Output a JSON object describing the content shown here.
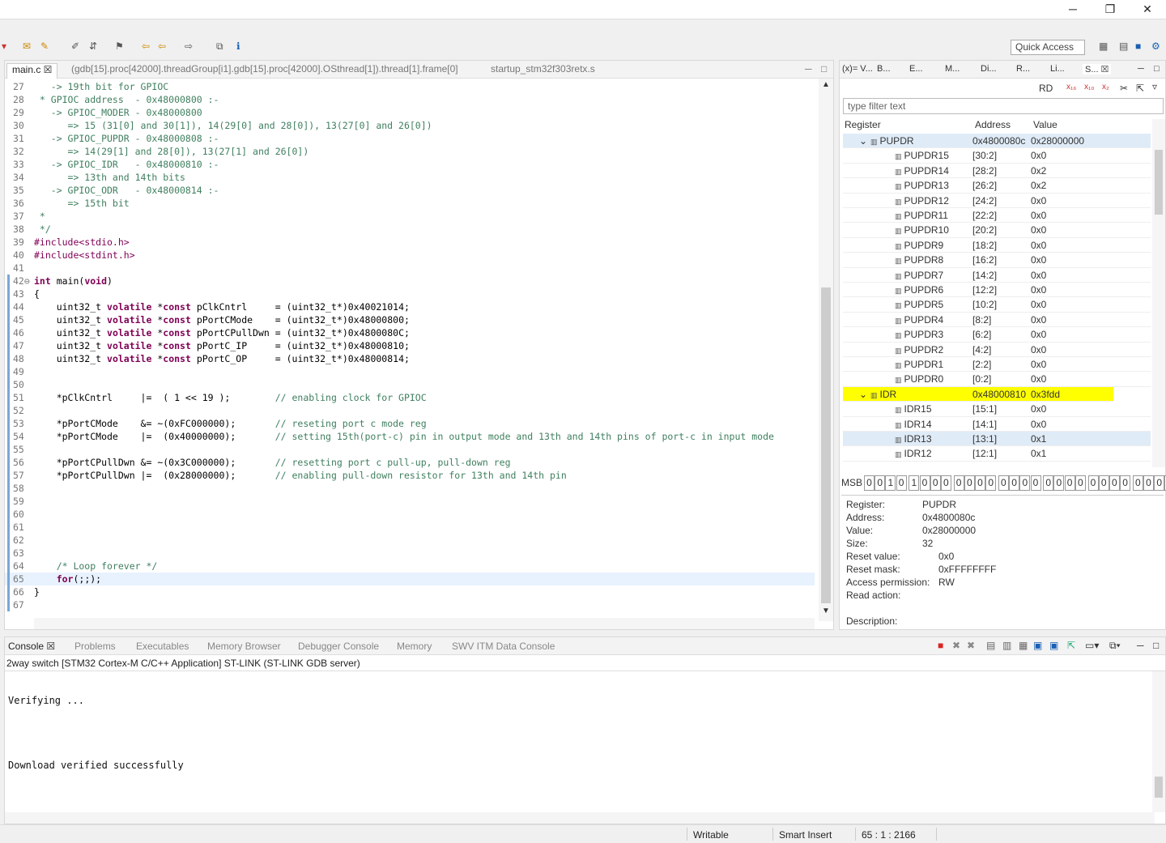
{
  "window": {
    "minimize": "─",
    "maximize": "❐",
    "close": "✕"
  },
  "toolbar": {
    "quick_access": "Quick Access"
  },
  "editor": {
    "tabs": [
      {
        "label": "main.c ☒"
      },
      {
        "label": "(gdb[15].proc[42000].threadGroup[i1].gdb[15].proc[42000].OSthread[1]).thread[1].frame[0]"
      },
      {
        "label": "startup_stm32f303retx.s"
      }
    ],
    "lines": [
      {
        "n": "27",
        "t": "   -> 19th bit for GPIOC"
      },
      {
        "n": "28",
        "t": " * GPIOC address  - 0x48000800 :-"
      },
      {
        "n": "29",
        "t": "   -> GPIOC_MODER - 0x48000800"
      },
      {
        "n": "30",
        "t": "      => 15 (31[0] and 30[1]), 14(29[0] and 28[0]), 13(27[0] and 26[0])"
      },
      {
        "n": "31",
        "t": "   -> GPIOC_PUPDR - 0x48000808 :-"
      },
      {
        "n": "32",
        "t": "      => 14(29[1] and 28[0]), 13(27[1] and 26[0])"
      },
      {
        "n": "33",
        "t": "   -> GPIOC_IDR   - 0x48000810 :-"
      },
      {
        "n": "34",
        "t": "      => 13th and 14th bits"
      },
      {
        "n": "35",
        "t": "   -> GPIOC_ODR   - 0x48000814 :-"
      },
      {
        "n": "36",
        "t": "      => 15th bit"
      },
      {
        "n": "37",
        "t": " *"
      },
      {
        "n": "38",
        "t": " */"
      },
      {
        "n": "39",
        "t": "#include<stdio.h>"
      },
      {
        "n": "40",
        "t": "#include<stdint.h>"
      },
      {
        "n": "41",
        "t": ""
      },
      {
        "n": "42⊖",
        "t": "int main(void)"
      },
      {
        "n": "43",
        "t": "{"
      },
      {
        "n": "44",
        "t": "    uint32_t volatile *const pClkCntrl     = (uint32_t*)0x40021014;"
      },
      {
        "n": "45",
        "t": "    uint32_t volatile *const pPortCMode    = (uint32_t*)0x48000800;"
      },
      {
        "n": "46",
        "t": "    uint32_t volatile *const pPortCPullDwn = (uint32_t*)0x4800080C;"
      },
      {
        "n": "47",
        "t": "    uint32_t volatile *const pPortC_IP     = (uint32_t*)0x48000810;"
      },
      {
        "n": "48",
        "t": "    uint32_t volatile *const pPortC_OP     = (uint32_t*)0x48000814;"
      },
      {
        "n": "49",
        "t": ""
      },
      {
        "n": "50",
        "t": ""
      },
      {
        "n": "51",
        "t": "    *pClkCntrl     |=  ( 1 << 19 );        // enabling clock for GPIOC"
      },
      {
        "n": "52",
        "t": ""
      },
      {
        "n": "53",
        "t": "    *pPortCMode    &= ~(0xFC000000);       // reseting port c mode reg"
      },
      {
        "n": "54",
        "t": "    *pPortCMode    |=  (0x40000000);       // setting 15th(port-c) pin in output mode and 13th and 14th pins of port-c in input mode"
      },
      {
        "n": "55",
        "t": ""
      },
      {
        "n": "56",
        "t": "    *pPortCPullDwn &= ~(0x3C000000);       // resetting port c pull-up, pull-down reg"
      },
      {
        "n": "57",
        "t": "    *pPortCPullDwn |=  (0x28000000);       // enabling pull-down resistor for 13th and 14th pin"
      },
      {
        "n": "58",
        "t": ""
      },
      {
        "n": "59",
        "t": ""
      },
      {
        "n": "60",
        "t": ""
      },
      {
        "n": "61",
        "t": ""
      },
      {
        "n": "62",
        "t": ""
      },
      {
        "n": "63",
        "t": ""
      },
      {
        "n": "64",
        "t": "    /* Loop forever */"
      },
      {
        "n": "65",
        "t": "    for(;;);"
      },
      {
        "n": "66",
        "t": "}"
      },
      {
        "n": "67",
        "t": ""
      }
    ]
  },
  "right_panel": {
    "tabs": [
      "(x)= V...",
      "B...",
      "E...",
      "M...",
      "Di...",
      "R...",
      "Li...",
      "S... ☒"
    ],
    "rd_label": "RD",
    "filter_placeholder": "type filter text",
    "columns": {
      "register": "Register",
      "address": "Address",
      "value": "Value"
    },
    "rows": [
      {
        "name": "PUPDR",
        "addr": "0x4800080c",
        "val": "0x28000000",
        "level": 0,
        "style": "sel"
      },
      {
        "name": "PUPDR15",
        "addr": "[30:2]",
        "val": "0x0",
        "level": 1
      },
      {
        "name": "PUPDR14",
        "addr": "[28:2]",
        "val": "0x2",
        "level": 1
      },
      {
        "name": "PUPDR13",
        "addr": "[26:2]",
        "val": "0x2",
        "level": 1
      },
      {
        "name": "PUPDR12",
        "addr": "[24:2]",
        "val": "0x0",
        "level": 1
      },
      {
        "name": "PUPDR11",
        "addr": "[22:2]",
        "val": "0x0",
        "level": 1
      },
      {
        "name": "PUPDR10",
        "addr": "[20:2]",
        "val": "0x0",
        "level": 1
      },
      {
        "name": "PUPDR9",
        "addr": "[18:2]",
        "val": "0x0",
        "level": 1
      },
      {
        "name": "PUPDR8",
        "addr": "[16:2]",
        "val": "0x0",
        "level": 1
      },
      {
        "name": "PUPDR7",
        "addr": "[14:2]",
        "val": "0x0",
        "level": 1
      },
      {
        "name": "PUPDR6",
        "addr": "[12:2]",
        "val": "0x0",
        "level": 1
      },
      {
        "name": "PUPDR5",
        "addr": "[10:2]",
        "val": "0x0",
        "level": 1
      },
      {
        "name": "PUPDR4",
        "addr": "[8:2]",
        "val": "0x0",
        "level": 1
      },
      {
        "name": "PUPDR3",
        "addr": "[6:2]",
        "val": "0x0",
        "level": 1
      },
      {
        "name": "PUPDR2",
        "addr": "[4:2]",
        "val": "0x0",
        "level": 1
      },
      {
        "name": "PUPDR1",
        "addr": "[2:2]",
        "val": "0x0",
        "level": 1
      },
      {
        "name": "PUPDR0",
        "addr": "[0:2]",
        "val": "0x0",
        "level": 1
      },
      {
        "name": "IDR",
        "addr": "0x48000810",
        "val": "0x3fdd",
        "level": 0,
        "style": "yel"
      },
      {
        "name": "IDR15",
        "addr": "[15:1]",
        "val": "0x0",
        "level": 1
      },
      {
        "name": "IDR14",
        "addr": "[14:1]",
        "val": "0x0",
        "level": 1
      },
      {
        "name": "IDR13",
        "addr": "[13:1]",
        "val": "0x1",
        "level": 1,
        "style": "sel"
      },
      {
        "name": "IDR12",
        "addr": "[12:1]",
        "val": "0x1",
        "level": 1
      }
    ],
    "msb_label": "MSB",
    "bits": [
      "0",
      "0",
      "1",
      "0",
      "1",
      "0",
      "0",
      "0",
      "0",
      "0",
      "0",
      "0",
      "0",
      "0",
      "0",
      "0",
      "0",
      "0",
      "0",
      "0",
      "0",
      "0",
      "0",
      "0",
      "0",
      "0",
      "0",
      "0"
    ],
    "details": [
      {
        "k": "Register:",
        "v": "PUPDR"
      },
      {
        "k": "Address:",
        "v": "0x4800080c"
      },
      {
        "k": "Value:",
        "v": "0x28000000"
      },
      {
        "k": "Size:",
        "v": "32"
      },
      {
        "k": "Reset value:",
        "v": "0x0"
      },
      {
        "k": "Reset mask:",
        "v": "0xFFFFFFFF"
      },
      {
        "k": "Access permission:",
        "v": "RW"
      },
      {
        "k": "Read action:",
        "v": ""
      },
      {
        "k": "",
        "v": ""
      },
      {
        "k": "Description:",
        "v": ""
      }
    ]
  },
  "console": {
    "tabs": [
      "Console ☒",
      "Problems",
      "Executables",
      "Memory Browser",
      "Debugger Console",
      "Memory",
      "SWV ITM Data Console"
    ],
    "header": "2way switch [STM32 Cortex-M C/C++ Application] ST-LINK (ST-LINK GDB server)",
    "lines": [
      "Verifying ...",
      "Download verified successfully"
    ]
  },
  "status": {
    "writable": "Writable",
    "insert": "Smart Insert",
    "position": "65 : 1 : 2166"
  }
}
